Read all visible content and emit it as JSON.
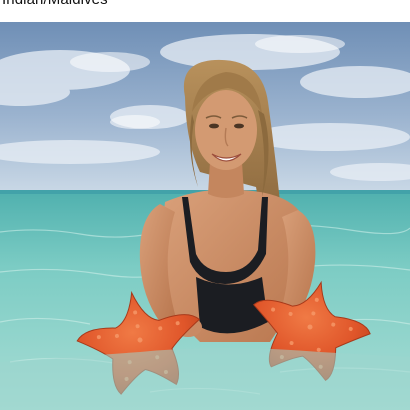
{
  "post": {
    "location": "Indian/Maldives"
  },
  "photo": {
    "subject": "woman-in-sea-holding-starfish-icon",
    "colors": {
      "sky_top": "#6f8fb6",
      "sky_bottom": "#c9d8e6",
      "sea_far": "#5db8b4",
      "sea_near": "#a8ddd4",
      "starfish": "#e0562a",
      "skin": "#c98a64",
      "hair": "#9a7446",
      "swimsuit": "#1b1d22"
    }
  }
}
